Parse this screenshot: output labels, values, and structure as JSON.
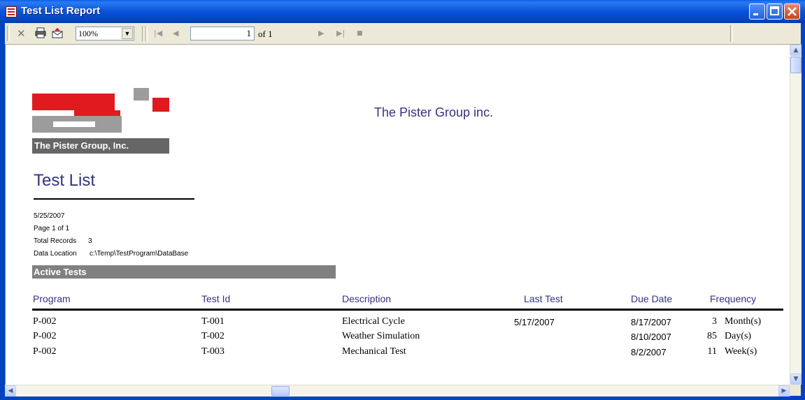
{
  "window": {
    "title": "Test List Report"
  },
  "toolbar": {
    "close_icon": "close-icon",
    "zoom": "100%",
    "page_current": "1",
    "page_of": "of 1"
  },
  "report": {
    "logo_caption": "The Pister Group, Inc.",
    "company_name": "The Pister Group inc.",
    "title": "Test List",
    "date": "5/25/2007",
    "page_info": "Page 1 of 1",
    "total_records_label": "Total Records",
    "total_records_value": "3",
    "data_location_label": "Data Location",
    "data_location_value": "c:\\Temp\\TestProgram\\DataBase",
    "section_title": "Active Tests",
    "columns": [
      "Program",
      "Test Id",
      "Description",
      "Last Test",
      "Due Date",
      "Frequency"
    ],
    "rows": [
      {
        "program": "P-002",
        "test_id": "T-001",
        "description": "Electrical Cycle",
        "last_test": "5/17/2007",
        "due_date": "8/17/2007",
        "freq_num": "3",
        "freq_unit": "Month(s)"
      },
      {
        "program": "P-002",
        "test_id": "T-002",
        "description": "Weather Simulation",
        "last_test": "",
        "due_date": "8/10/2007",
        "freq_num": "85",
        "freq_unit": "Day(s)"
      },
      {
        "program": "P-002",
        "test_id": "T-003",
        "description": "Mechanical Test",
        "last_test": "",
        "due_date": "8/2/2007",
        "freq_num": "11",
        "freq_unit": "Week(s)"
      }
    ]
  },
  "colors": {
    "title_bar": "#0853D8",
    "report_accent": "#333380",
    "logo_red": "#E11A1F",
    "logo_gray": "#9C9C9C"
  }
}
